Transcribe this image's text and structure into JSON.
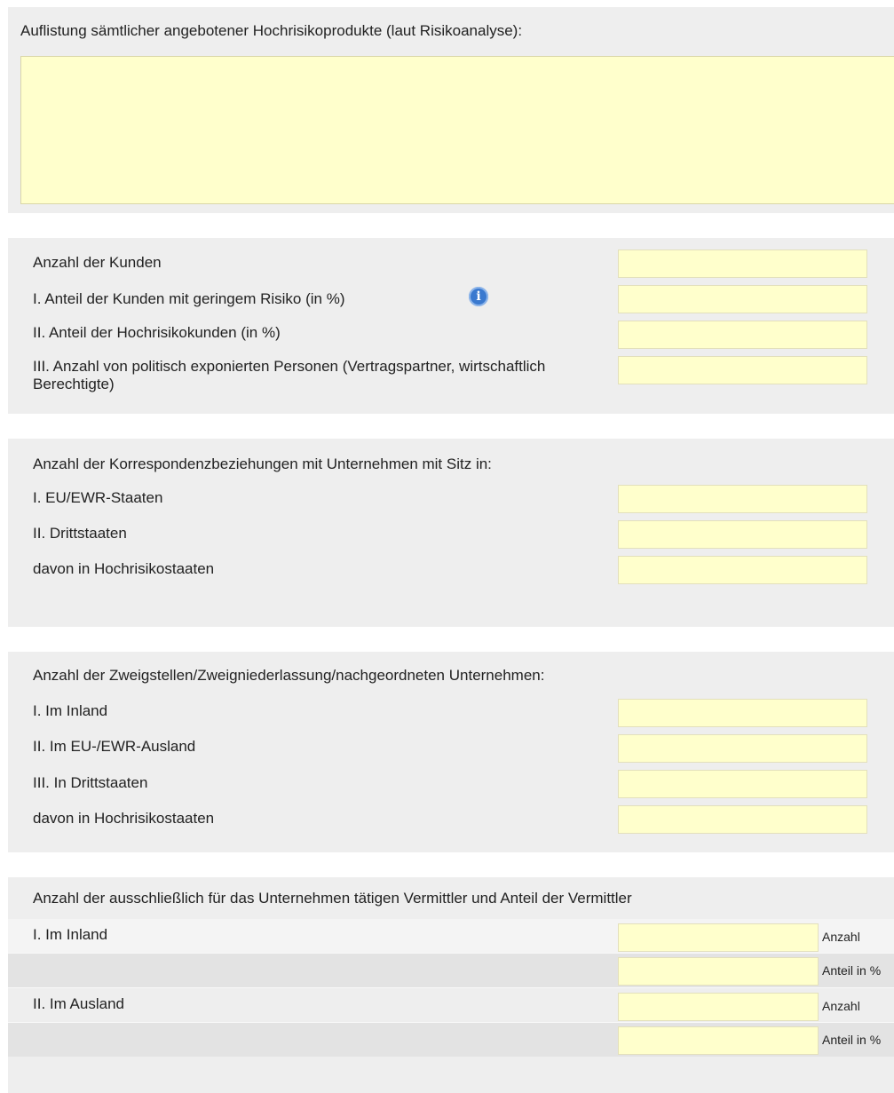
{
  "products": {
    "label": "Auflistung sämtlicher angebotener Hochrisikoprodukte (laut Risikoanalyse):",
    "value": ""
  },
  "customers": {
    "rows": [
      {
        "label": "Anzahl der Kunden",
        "value": ""
      },
      {
        "label": "I. Anteil der Kunden mit geringem Risiko (in %)",
        "value": ""
      },
      {
        "label": "II. Anteil der Hochrisikokunden (in %)",
        "value": ""
      },
      {
        "label": "III. Anzahl von politisch exponierten Personen (Vertragspartner, wirtschaftlich Berechtigte)",
        "value": ""
      }
    ],
    "info_icon": "info-icon",
    "info_symbol": "i"
  },
  "correspondent": {
    "heading": "Anzahl der Korrespondenzbeziehungen mit Unternehmen mit Sitz in:",
    "rows": [
      {
        "label": "I. EU/EWR-Staaten",
        "value": ""
      },
      {
        "label": "II. Drittstaaten",
        "value": ""
      },
      {
        "label": "davon in Hochrisikostaaten",
        "value": ""
      }
    ]
  },
  "branches": {
    "heading": "Anzahl der Zweigstellen/Zweigniederlassung/nachgeordneten Unternehmen:",
    "rows": [
      {
        "label": "I. Im Inland",
        "value": ""
      },
      {
        "label": "II. Im EU-/EWR-Ausland",
        "value": ""
      },
      {
        "label": "III. In Drittstaaten",
        "value": ""
      },
      {
        "label": "davon in Hochrisikostaaten",
        "value": ""
      }
    ]
  },
  "intermediaries": {
    "heading": "Anzahl der ausschließlich für das  Unternehmen tätigen Vermittler und Anteil der Vermittler",
    "rows": [
      {
        "label": "I. Im Inland",
        "value": "",
        "unit": "Anzahl"
      },
      {
        "label": "",
        "value": "",
        "unit": "Anteil in %"
      },
      {
        "label": "II. Im Ausland",
        "value": "",
        "unit": "Anzahl"
      },
      {
        "label": "",
        "value": "",
        "unit": "Anteil in %"
      }
    ]
  },
  "colors": {
    "field_background": "#ffffcc",
    "panel_background": "#eeeeee",
    "info_icon": "#3a79cf"
  }
}
